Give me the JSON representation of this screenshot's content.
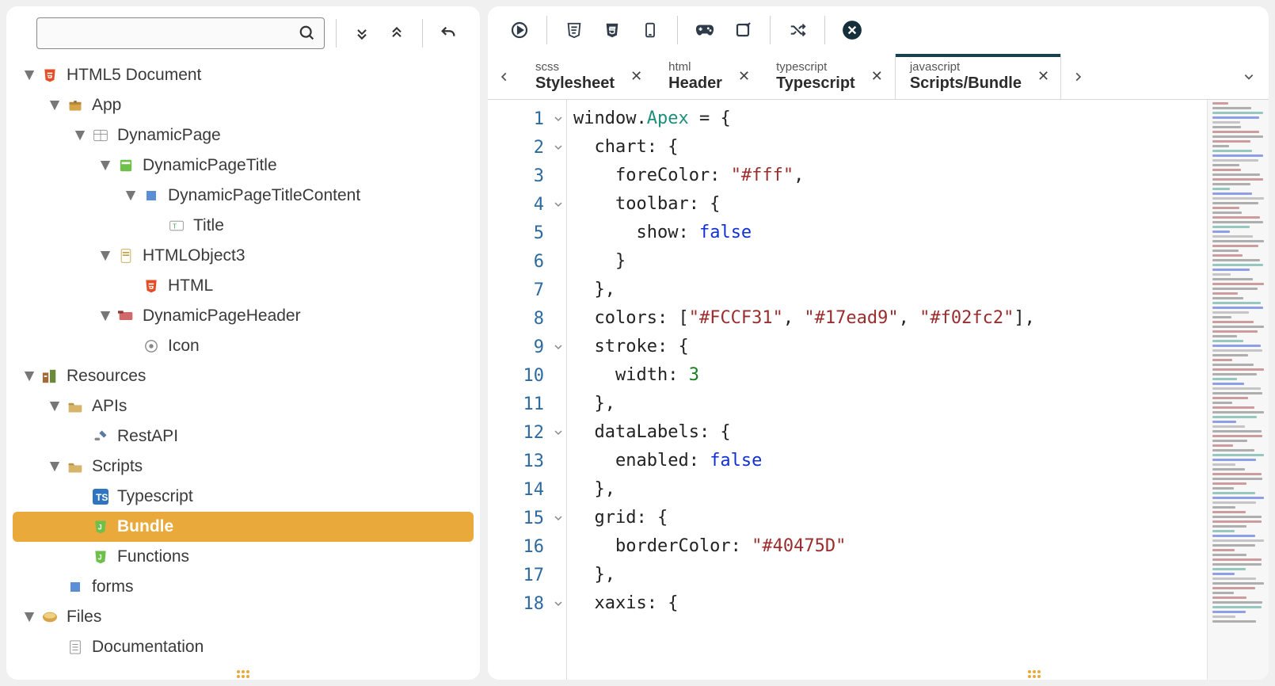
{
  "sidebar": {
    "search_placeholder": "",
    "tree": [
      {
        "depth": 0,
        "twisty": "▼",
        "icon": "html5",
        "label": "HTML5 Document"
      },
      {
        "depth": 1,
        "twisty": "▼",
        "icon": "pkg",
        "label": "App"
      },
      {
        "depth": 2,
        "twisty": "▼",
        "icon": "grid",
        "label": "DynamicPage"
      },
      {
        "depth": 3,
        "twisty": "▼",
        "icon": "title",
        "label": "DynamicPageTitle"
      },
      {
        "depth": 4,
        "twisty": "▼",
        "icon": "block",
        "label": "DynamicPageTitleContent"
      },
      {
        "depth": 5,
        "twisty": "",
        "icon": "text",
        "label": "Title"
      },
      {
        "depth": 3,
        "twisty": "▼",
        "icon": "doc",
        "label": "HTMLObject3"
      },
      {
        "depth": 4,
        "twisty": "",
        "icon": "html5",
        "label": "HTML"
      },
      {
        "depth": 3,
        "twisty": "▼",
        "icon": "header",
        "label": "DynamicPageHeader"
      },
      {
        "depth": 4,
        "twisty": "",
        "icon": "iconimg",
        "label": "Icon"
      },
      {
        "depth": 0,
        "twisty": "▼",
        "icon": "res",
        "label": "Resources"
      },
      {
        "depth": 1,
        "twisty": "▼",
        "icon": "folder",
        "label": "APIs"
      },
      {
        "depth": 2,
        "twisty": "",
        "icon": "api",
        "label": "RestAPI"
      },
      {
        "depth": 1,
        "twisty": "▼",
        "icon": "folder",
        "label": "Scripts"
      },
      {
        "depth": 2,
        "twisty": "",
        "icon": "ts",
        "label": "Typescript"
      },
      {
        "depth": 2,
        "twisty": "",
        "icon": "js",
        "label": "Bundle",
        "selected": true
      },
      {
        "depth": 2,
        "twisty": "",
        "icon": "js",
        "label": "Functions"
      },
      {
        "depth": 1,
        "twisty": "",
        "icon": "form",
        "label": "forms"
      },
      {
        "depth": 0,
        "twisty": "▼",
        "icon": "files",
        "label": "Files"
      },
      {
        "depth": 1,
        "twisty": "",
        "icon": "docfile",
        "label": "Documentation"
      }
    ]
  },
  "tabs": [
    {
      "top": "scss",
      "bottom": "Stylesheet",
      "active": false
    },
    {
      "top": "html",
      "bottom": "Header",
      "active": false
    },
    {
      "top": "typescript",
      "bottom": "Typescript",
      "active": false
    },
    {
      "top": "javascript",
      "bottom": "Scripts/Bundle",
      "active": true
    }
  ],
  "code_lines": [
    {
      "n": 1,
      "fold": "v",
      "tokens": [
        [
          "prop",
          "window."
        ],
        [
          "ident",
          "Apex"
        ],
        [
          "prop",
          " = {"
        ]
      ]
    },
    {
      "n": 2,
      "fold": "v",
      "tokens": [
        [
          "prop",
          "  chart: {"
        ]
      ]
    },
    {
      "n": 3,
      "fold": "",
      "tokens": [
        [
          "prop",
          "    foreColor: "
        ],
        [
          "str",
          "\"#fff\""
        ],
        [
          "prop",
          ","
        ]
      ]
    },
    {
      "n": 4,
      "fold": "v",
      "tokens": [
        [
          "prop",
          "    toolbar: {"
        ]
      ]
    },
    {
      "n": 5,
      "fold": "",
      "tokens": [
        [
          "prop",
          "      show: "
        ],
        [
          "kw",
          "false"
        ]
      ]
    },
    {
      "n": 6,
      "fold": "",
      "tokens": [
        [
          "prop",
          "    }"
        ]
      ]
    },
    {
      "n": 7,
      "fold": "",
      "tokens": [
        [
          "prop",
          "  },"
        ]
      ]
    },
    {
      "n": 8,
      "fold": "",
      "tokens": [
        [
          "prop",
          "  colors: ["
        ],
        [
          "str",
          "\"#FCCF31\""
        ],
        [
          "prop",
          ", "
        ],
        [
          "str",
          "\"#17ead9\""
        ],
        [
          "prop",
          ", "
        ],
        [
          "str",
          "\"#f02fc2\""
        ],
        [
          "prop",
          "],"
        ]
      ]
    },
    {
      "n": 9,
      "fold": "v",
      "tokens": [
        [
          "prop",
          "  stroke: {"
        ]
      ]
    },
    {
      "n": 10,
      "fold": "",
      "tokens": [
        [
          "prop",
          "    width: "
        ],
        [
          "num",
          "3"
        ]
      ]
    },
    {
      "n": 11,
      "fold": "",
      "tokens": [
        [
          "prop",
          "  },"
        ]
      ]
    },
    {
      "n": 12,
      "fold": "v",
      "tokens": [
        [
          "prop",
          "  dataLabels: {"
        ]
      ]
    },
    {
      "n": 13,
      "fold": "",
      "tokens": [
        [
          "prop",
          "    enabled: "
        ],
        [
          "kw",
          "false"
        ]
      ]
    },
    {
      "n": 14,
      "fold": "",
      "tokens": [
        [
          "prop",
          "  },"
        ]
      ]
    },
    {
      "n": 15,
      "fold": "v",
      "tokens": [
        [
          "prop",
          "  grid: {"
        ]
      ]
    },
    {
      "n": 16,
      "fold": "",
      "tokens": [
        [
          "prop",
          "    borderColor: "
        ],
        [
          "str",
          "\"#40475D\""
        ]
      ]
    },
    {
      "n": 17,
      "fold": "",
      "tokens": [
        [
          "prop",
          "  },"
        ]
      ]
    },
    {
      "n": 18,
      "fold": "v",
      "tokens": [
        [
          "prop",
          "  xaxis: {"
        ]
      ]
    }
  ]
}
